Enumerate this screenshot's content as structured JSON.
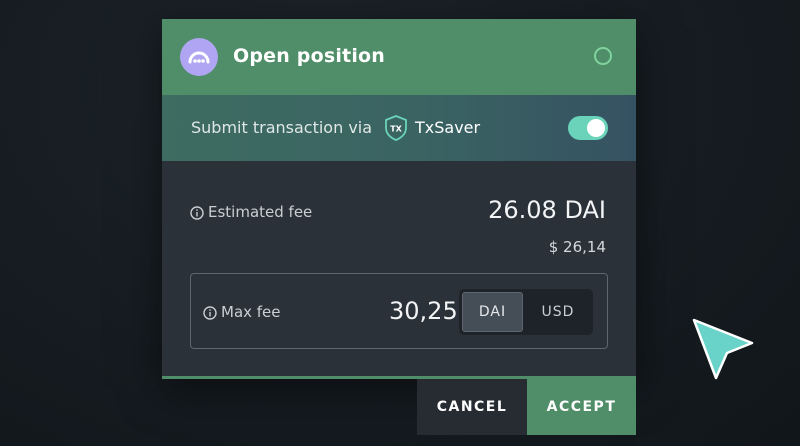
{
  "dialog": {
    "title": "Open position",
    "avatar_icon": "dots-avatar-icon",
    "status_icon": "status-ring-icon",
    "via": {
      "text": "Submit transaction via",
      "brand_icon": "txsaver-shield-icon",
      "brand_icon_text": "TX",
      "brand": "TxSaver",
      "toggle_on": true
    },
    "estimated_fee": {
      "label": "Estimated fee",
      "value": "26.08 DAI",
      "usd": "$ 26,14"
    },
    "max_fee": {
      "label": "Max fee",
      "value": "30,25",
      "currencies": [
        "DAI",
        "USD"
      ],
      "selected_currency": "DAI"
    }
  },
  "buttons": {
    "cancel": "CANCEL",
    "accept": "ACCEPT"
  },
  "colors": {
    "accent": "#4f8e69",
    "toggle": "#6ad3b9",
    "avatar": "#b0a5f2",
    "cursor": "#6ad3c9"
  }
}
